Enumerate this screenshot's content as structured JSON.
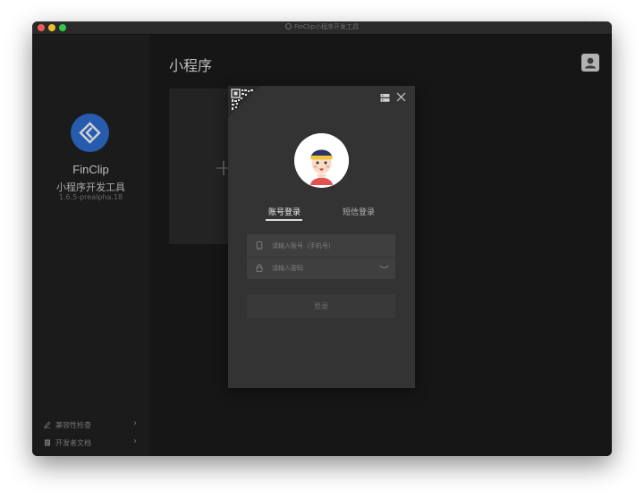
{
  "window": {
    "title": "FinClip小程序开发工具"
  },
  "sidebar": {
    "brand_name": "FinClip",
    "brand_subtitle": "小程序开发工具",
    "version": "1.6.5-prealpha.18",
    "links": [
      {
        "label": "兼容性检查",
        "icon": "pencil-icon"
      },
      {
        "label": "开发者文档",
        "icon": "document-icon"
      }
    ]
  },
  "main": {
    "page_title": "小程序",
    "new_card_symbol": "+"
  },
  "login_modal": {
    "tabs": [
      {
        "label": "账号登录",
        "active": true
      },
      {
        "label": "短信登录",
        "active": false
      }
    ],
    "phone_placeholder": "请输入账号（手机号）",
    "password_placeholder": "请输入密码",
    "login_button": "登录"
  },
  "colors": {
    "accent": "#2f6fd3",
    "window_bg": "#202020",
    "modal_bg": "#333333"
  }
}
